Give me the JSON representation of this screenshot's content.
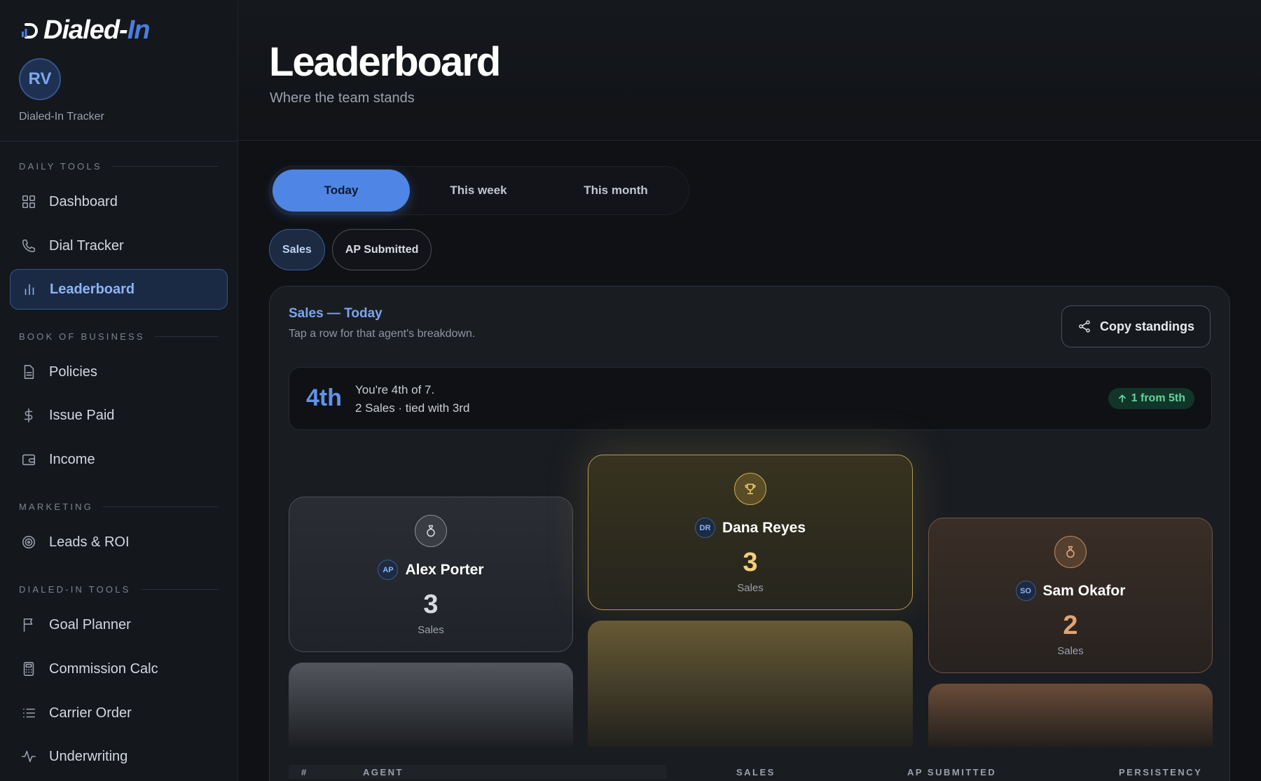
{
  "brand": {
    "name_main": "Dialed-",
    "name_accent": "In"
  },
  "profile": {
    "initials": "RV",
    "subtitle": "Dialed-In Tracker"
  },
  "sidebar": {
    "sections": [
      {
        "label": "DAILY TOOLS"
      },
      {
        "label": "BOOK OF BUSINESS"
      },
      {
        "label": "MARKETING"
      },
      {
        "label": "DIALED-IN TOOLS"
      }
    ],
    "items": [
      {
        "label": "Dashboard",
        "icon": "grid-icon"
      },
      {
        "label": "Dial Tracker",
        "icon": "phone-icon"
      },
      {
        "label": "Leaderboard",
        "icon": "bar-chart-icon",
        "active": true
      },
      {
        "label": "Policies",
        "icon": "document-icon"
      },
      {
        "label": "Issue Paid",
        "icon": "dollar-icon"
      },
      {
        "label": "Income",
        "icon": "wallet-icon"
      },
      {
        "label": "Leads & ROI",
        "icon": "target-icon"
      },
      {
        "label": "Goal Planner",
        "icon": "flag-icon"
      },
      {
        "label": "Commission Calc",
        "icon": "calculator-icon"
      },
      {
        "label": "Carrier Order",
        "icon": "list-icon"
      },
      {
        "label": "Underwriting",
        "icon": "activity-icon"
      }
    ]
  },
  "header": {
    "title": "Leaderboard",
    "subtitle": "Where the team stands"
  },
  "period_tabs": [
    {
      "label": "Today",
      "active": true
    },
    {
      "label": "This week",
      "active": false
    },
    {
      "label": "This month",
      "active": false
    }
  ],
  "metric_pills": [
    {
      "label": "Sales",
      "active": true
    },
    {
      "label": "AP Submitted",
      "active": false
    }
  ],
  "card": {
    "title": "Sales — Today",
    "subtitle": "Tap a row for that agent's breakdown.",
    "copy_label": "Copy standings"
  },
  "rank": {
    "position": "4th",
    "line1": "You're 4th of 7.",
    "line2": "2 Sales · tied with 3rd",
    "delta": "1 from 5th"
  },
  "podium": {
    "first": {
      "initials": "DR",
      "name": "Dana Reyes",
      "score": "3",
      "unit": "Sales"
    },
    "second": {
      "initials": "AP",
      "name": "Alex Porter",
      "score": "3",
      "unit": "Sales"
    },
    "third": {
      "initials": "SO",
      "name": "Sam Okafor",
      "score": "2",
      "unit": "Sales"
    }
  },
  "table": {
    "headers": {
      "rank": "#",
      "agent": "AGENT",
      "sales": "SALES",
      "ap": "AP SUBMITTED",
      "persistency": "PERSISTENCY"
    }
  },
  "colors": {
    "accent": "#4f86e6",
    "gold": "#f2cf7a",
    "silver": "#d7dae0",
    "bronze": "#e2a475",
    "positive": "#5fd59a"
  }
}
